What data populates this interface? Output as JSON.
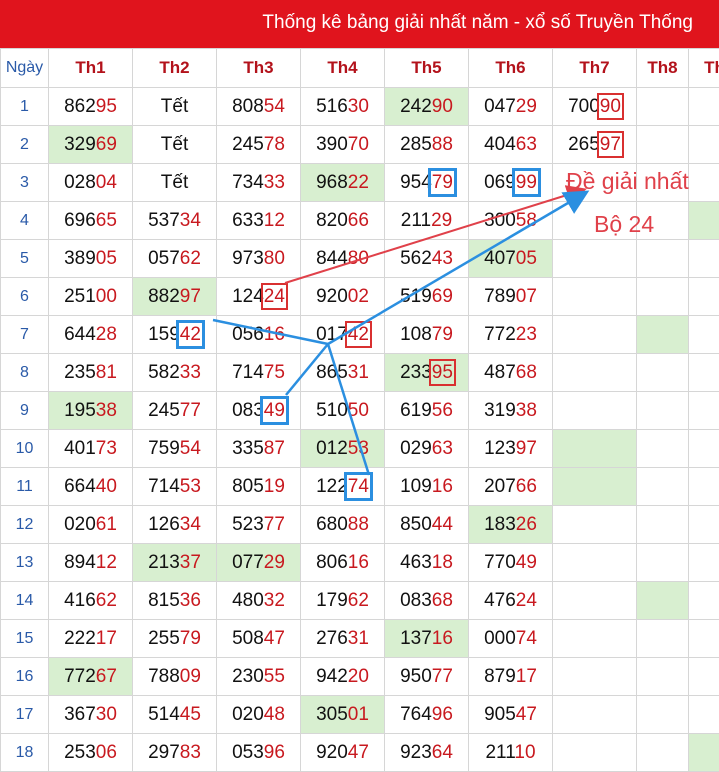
{
  "header": {
    "title": "Thống kê bảng giải nhất năm - xổ số Truyền Thống"
  },
  "table": {
    "columns": [
      "Ngày",
      "Th1",
      "Th2",
      "Th3",
      "Th4",
      "Th5",
      "Th6",
      "Th7",
      "Th8",
      "Th"
    ],
    "rows": [
      {
        "day": "1",
        "cells": [
          [
            "862",
            "95"
          ],
          [
            "Tết",
            ""
          ],
          [
            "808",
            "54"
          ],
          [
            "516",
            "30"
          ],
          [
            "242",
            "90"
          ],
          [
            "047",
            "29"
          ],
          [
            "700",
            "90"
          ],
          [
            "",
            ""
          ],
          [
            "",
            ""
          ]
        ]
      },
      {
        "day": "2",
        "cells": [
          [
            "329",
            "69"
          ],
          [
            "Tết",
            ""
          ],
          [
            "245",
            "78"
          ],
          [
            "390",
            "70"
          ],
          [
            "285",
            "88"
          ],
          [
            "404",
            "63"
          ],
          [
            "265",
            "97"
          ],
          [
            "",
            ""
          ],
          [
            "",
            ""
          ]
        ]
      },
      {
        "day": "3",
        "cells": [
          [
            "028",
            "04"
          ],
          [
            "Tết",
            ""
          ],
          [
            "734",
            "33"
          ],
          [
            "968",
            "22"
          ],
          [
            "954",
            "79"
          ],
          [
            "069",
            "99"
          ],
          [
            "",
            ""
          ],
          [
            "",
            ""
          ],
          [
            "",
            ""
          ]
        ]
      },
      {
        "day": "4",
        "cells": [
          [
            "696",
            "65"
          ],
          [
            "537",
            "34"
          ],
          [
            "633",
            "12"
          ],
          [
            "820",
            "66"
          ],
          [
            "211",
            "29"
          ],
          [
            "300",
            "58"
          ],
          [
            "",
            ""
          ],
          [
            "",
            ""
          ],
          [
            "",
            ""
          ]
        ]
      },
      {
        "day": "5",
        "cells": [
          [
            "389",
            "05"
          ],
          [
            "057",
            "62"
          ],
          [
            "973",
            "80"
          ],
          [
            "844",
            "80"
          ],
          [
            "562",
            "43"
          ],
          [
            "407",
            "05"
          ],
          [
            "",
            ""
          ],
          [
            "",
            ""
          ],
          [
            "",
            ""
          ]
        ]
      },
      {
        "day": "6",
        "cells": [
          [
            "251",
            "00"
          ],
          [
            "882",
            "97"
          ],
          [
            "124",
            "24"
          ],
          [
            "920",
            "02"
          ],
          [
            "519",
            "69"
          ],
          [
            "789",
            "07"
          ],
          [
            "",
            ""
          ],
          [
            "",
            ""
          ],
          [
            "",
            ""
          ]
        ]
      },
      {
        "day": "7",
        "cells": [
          [
            "644",
            "28"
          ],
          [
            "159",
            "42"
          ],
          [
            "056",
            "16"
          ],
          [
            "017",
            "42"
          ],
          [
            "108",
            "79"
          ],
          [
            "772",
            "23"
          ],
          [
            "",
            ""
          ],
          [
            "",
            ""
          ],
          [
            "",
            ""
          ]
        ]
      },
      {
        "day": "8",
        "cells": [
          [
            "235",
            "81"
          ],
          [
            "582",
            "33"
          ],
          [
            "714",
            "75"
          ],
          [
            "865",
            "31"
          ],
          [
            "233",
            "95"
          ],
          [
            "487",
            "68"
          ],
          [
            "",
            ""
          ],
          [
            "",
            ""
          ],
          [
            "",
            ""
          ]
        ]
      },
      {
        "day": "9",
        "cells": [
          [
            "195",
            "38"
          ],
          [
            "245",
            "77"
          ],
          [
            "083",
            "49"
          ],
          [
            "510",
            "50"
          ],
          [
            "619",
            "56"
          ],
          [
            "319",
            "38"
          ],
          [
            "",
            ""
          ],
          [
            "",
            ""
          ],
          [
            "",
            ""
          ]
        ]
      },
      {
        "day": "10",
        "cells": [
          [
            "401",
            "73"
          ],
          [
            "759",
            "54"
          ],
          [
            "335",
            "87"
          ],
          [
            "012",
            "53"
          ],
          [
            "029",
            "63"
          ],
          [
            "123",
            "97"
          ],
          [
            "",
            ""
          ],
          [
            "",
            ""
          ],
          [
            "",
            ""
          ]
        ]
      },
      {
        "day": "11",
        "cells": [
          [
            "664",
            "40"
          ],
          [
            "714",
            "53"
          ],
          [
            "805",
            "19"
          ],
          [
            "122",
            "74"
          ],
          [
            "109",
            "16"
          ],
          [
            "207",
            "66"
          ],
          [
            "",
            ""
          ],
          [
            "",
            ""
          ],
          [
            "",
            ""
          ]
        ]
      },
      {
        "day": "12",
        "cells": [
          [
            "020",
            "61"
          ],
          [
            "126",
            "34"
          ],
          [
            "523",
            "77"
          ],
          [
            "680",
            "88"
          ],
          [
            "850",
            "44"
          ],
          [
            "183",
            "26"
          ],
          [
            "",
            ""
          ],
          [
            "",
            ""
          ],
          [
            "",
            ""
          ]
        ]
      },
      {
        "day": "13",
        "cells": [
          [
            "894",
            "12"
          ],
          [
            "213",
            "37"
          ],
          [
            "077",
            "29"
          ],
          [
            "806",
            "16"
          ],
          [
            "463",
            "18"
          ],
          [
            "770",
            "49"
          ],
          [
            "",
            ""
          ],
          [
            "",
            ""
          ],
          [
            "",
            ""
          ]
        ]
      },
      {
        "day": "14",
        "cells": [
          [
            "416",
            "62"
          ],
          [
            "815",
            "36"
          ],
          [
            "480",
            "32"
          ],
          [
            "179",
            "62"
          ],
          [
            "083",
            "68"
          ],
          [
            "476",
            "24"
          ],
          [
            "",
            ""
          ],
          [
            "",
            ""
          ],
          [
            "",
            ""
          ]
        ]
      },
      {
        "day": "15",
        "cells": [
          [
            "222",
            "17"
          ],
          [
            "255",
            "79"
          ],
          [
            "508",
            "47"
          ],
          [
            "276",
            "31"
          ],
          [
            "137",
            "16"
          ],
          [
            "000",
            "74"
          ],
          [
            "",
            ""
          ],
          [
            "",
            ""
          ],
          [
            "",
            ""
          ]
        ]
      },
      {
        "day": "16",
        "cells": [
          [
            "772",
            "67"
          ],
          [
            "788",
            "09"
          ],
          [
            "230",
            "55"
          ],
          [
            "942",
            "20"
          ],
          [
            "950",
            "77"
          ],
          [
            "879",
            "17"
          ],
          [
            "",
            ""
          ],
          [
            "",
            ""
          ],
          [
            "",
            ""
          ]
        ]
      },
      {
        "day": "17",
        "cells": [
          [
            "367",
            "30"
          ],
          [
            "514",
            "45"
          ],
          [
            "020",
            "48"
          ],
          [
            "305",
            "01"
          ],
          [
            "764",
            "96"
          ],
          [
            "905",
            "47"
          ],
          [
            "",
            ""
          ],
          [
            "",
            ""
          ],
          [
            "",
            ""
          ]
        ]
      },
      {
        "day": "18",
        "cells": [
          [
            "253",
            "06"
          ],
          [
            "297",
            "83"
          ],
          [
            "053",
            "96"
          ],
          [
            "920",
            "47"
          ],
          [
            "923",
            "64"
          ],
          [
            "211",
            "10"
          ],
          [
            "",
            ""
          ],
          [
            "",
            ""
          ],
          [
            "",
            ""
          ]
        ]
      }
    ]
  },
  "annotation": {
    "line1": "Đề giải nhất",
    "line2": "Bộ 24"
  },
  "colors": {
    "banner": "#e0141d",
    "highlight": "#d8efd0",
    "red_box": "#d93030",
    "blue_box": "#2b8fe0"
  }
}
